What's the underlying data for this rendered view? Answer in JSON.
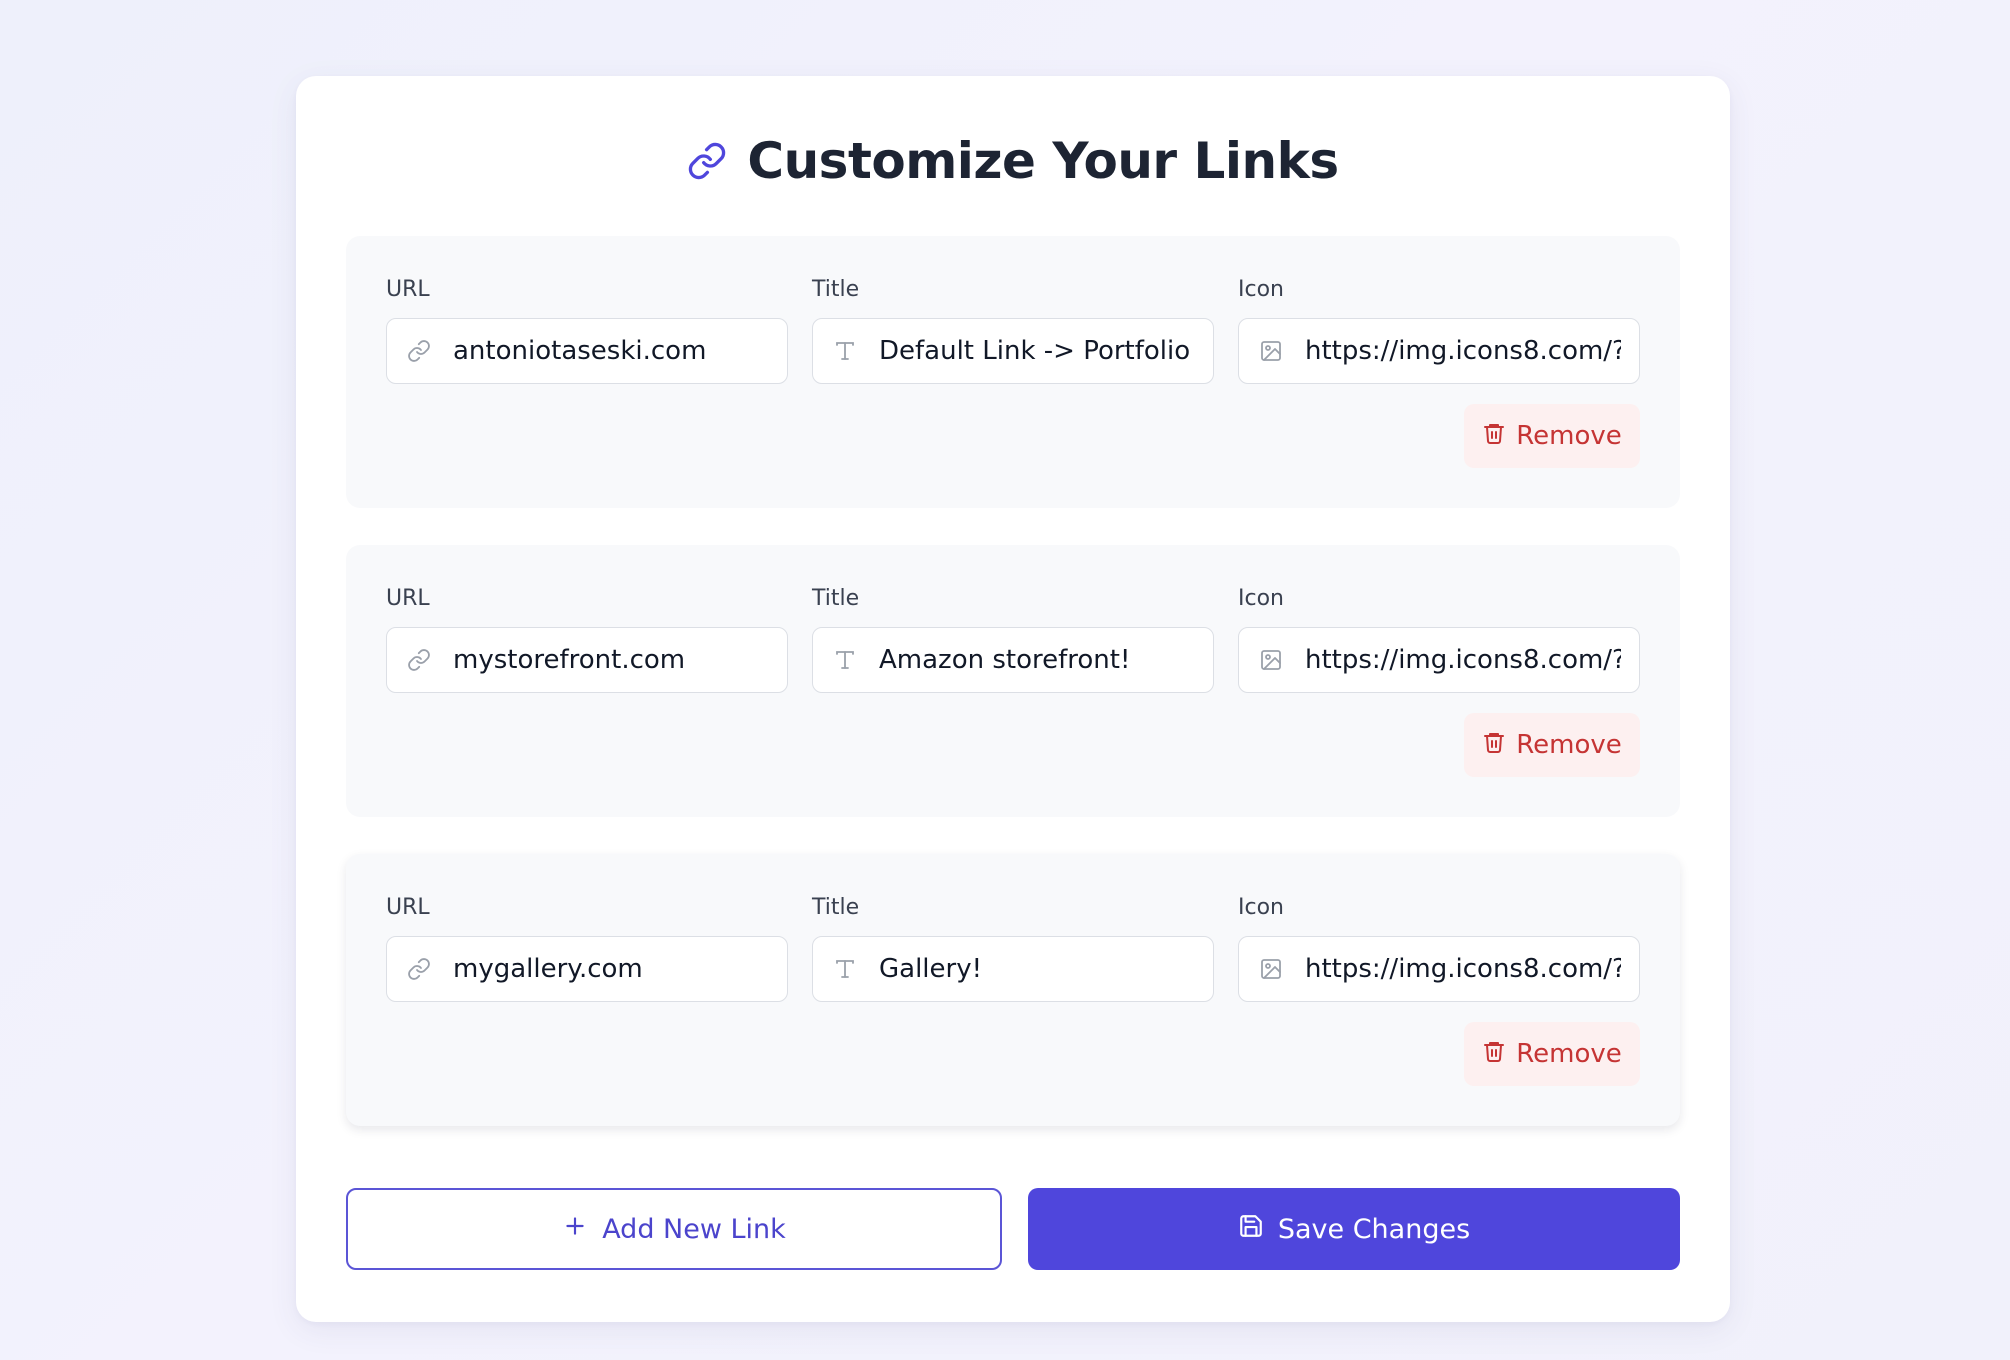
{
  "page": {
    "title": "Customize Your Links",
    "accent_color": "#4f46dc",
    "danger_color": "#c53434"
  },
  "links": [
    {
      "url_label": "URL",
      "url_value": "antoniotaseski.com",
      "title_label": "Title",
      "title_value": "Default Link -> Portfolio",
      "icon_label": "Icon",
      "icon_value": "https://img.icons8.com/?",
      "remove_label": "Remove"
    },
    {
      "url_label": "URL",
      "url_value": "mystorefront.com",
      "title_label": "Title",
      "title_value": "Amazon storefront!",
      "icon_label": "Icon",
      "icon_value": "https://img.icons8.com/?",
      "remove_label": "Remove"
    },
    {
      "url_label": "URL",
      "url_value": "mygallery.com",
      "title_label": "Title",
      "title_value": "Gallery!",
      "icon_label": "Icon",
      "icon_value": "https://img.icons8.com/?",
      "remove_label": "Remove"
    }
  ],
  "actions": {
    "add_label": "Add New Link",
    "save_label": "Save Changes"
  },
  "icons": {
    "header": "link-icon",
    "url_field": "link-icon",
    "title_field": "text-icon",
    "icon_field": "image-icon",
    "remove": "trash-icon",
    "add": "plus-icon",
    "save": "floppy-disk-icon"
  }
}
